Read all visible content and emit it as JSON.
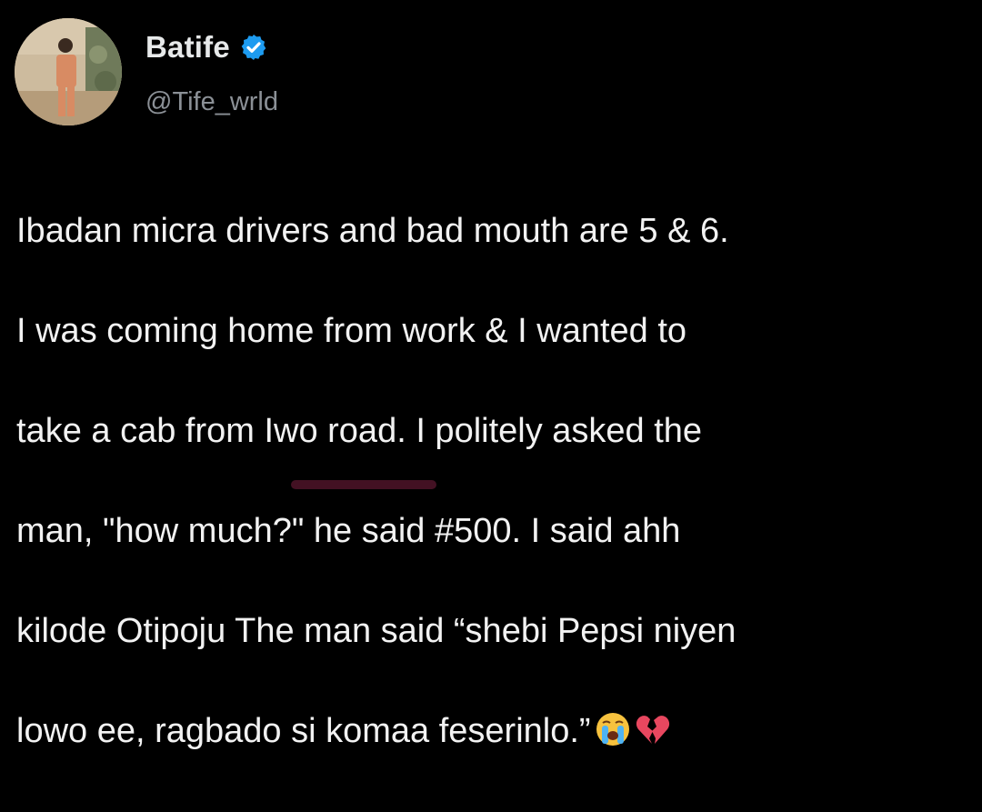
{
  "author": {
    "display_name": "Batife",
    "handle": "@Tife_wrld",
    "verified": true,
    "verified_icon": "verified-badge-icon",
    "verified_color": "#1d9bf0"
  },
  "tweet": {
    "lines": [
      "Ibadan micra drivers and bad mouth are 5 & 6.",
      "I was coming home from work & I wanted to",
      "take a cab from Iwo road. I politely asked the",
      "man, \"how much?\" he said #500. I said ahh",
      "kilode Otipoju The man said “shebi Pepsi niyen",
      "lowo ee, ragbado si komaa feserinlo.”"
    ],
    "emojis": [
      "loudly-crying-face-icon",
      "broken-heart-icon"
    ]
  },
  "colors": {
    "background": "#000000",
    "name": "#e7e9ea",
    "handle": "#8b9096",
    "text": "#f2f2f2"
  }
}
